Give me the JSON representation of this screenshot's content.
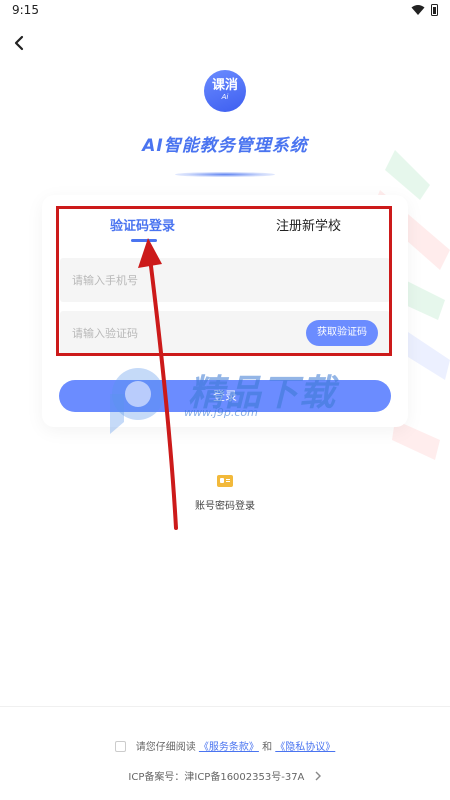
{
  "status_bar": {
    "time": "9:15"
  },
  "logo": {
    "main": "课消",
    "sub": "Ai"
  },
  "app_title": "AI智能教务管理系统",
  "tabs": [
    {
      "label": "验证码登录",
      "active": true
    },
    {
      "label": "注册新学校",
      "active": false
    }
  ],
  "form": {
    "phone_placeholder": "请输入手机号",
    "code_placeholder": "请输入验证码",
    "get_code_label": "获取验证码",
    "login_label": "登录"
  },
  "alt_login": {
    "label": "账号密码登录",
    "icon": "id-card-icon"
  },
  "agreement": {
    "prefix": "请您仔细阅读",
    "terms": "《服务条款》",
    "and": "和",
    "privacy": "《隐私协议》"
  },
  "icp": "ICP备案号：津ICP备16002353号-37A",
  "watermark": {
    "text": "精品下载",
    "url": "www.j9p.com"
  },
  "colors": {
    "accent": "#4a74f0",
    "button": "#6b8cff",
    "annotation": "#cc1a1a"
  }
}
